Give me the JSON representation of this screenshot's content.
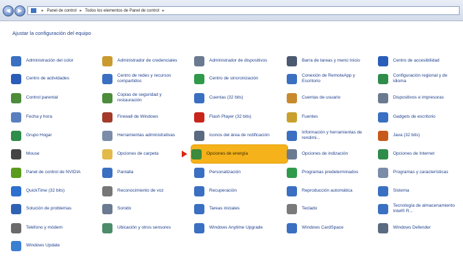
{
  "address_bar": {
    "path": [
      "Panel de control",
      "Todos los elementos de Panel de control"
    ]
  },
  "heading": "Ajustar la configuración del equipo",
  "items": [
    {
      "label": "Administración del color",
      "icon": "color-management-icon",
      "color": "#3a6fc2"
    },
    {
      "label": "Centro de actividades",
      "icon": "flag-icon",
      "color": "#2a5db8"
    },
    {
      "label": "Control parental",
      "icon": "parental-control-icon",
      "color": "#4c8c3a"
    },
    {
      "label": "Fecha y hora",
      "icon": "clock-icon",
      "color": "#5a7fbf"
    },
    {
      "label": "Grupo Hogar",
      "icon": "homegroup-icon",
      "color": "#2f8c4a"
    },
    {
      "label": "Mouse",
      "icon": "mouse-icon",
      "color": "#444444"
    },
    {
      "label": "Panel de control de NVIDIA",
      "icon": "nvidia-icon",
      "color": "#5a9a1c"
    },
    {
      "label": "QuickTime (32 bits)",
      "icon": "quicktime-icon",
      "color": "#2e6fd0"
    },
    {
      "label": "Solución de problemas",
      "icon": "troubleshoot-icon",
      "color": "#2f62b3"
    },
    {
      "label": "Teléfono y módem",
      "icon": "phone-icon",
      "color": "#6a6a6a"
    },
    {
      "label": "Windows Update",
      "icon": "windows-update-icon",
      "color": "#3b7fd1"
    },
    {
      "label": "Administrador de credenciales",
      "icon": "credentials-icon",
      "color": "#c99a2e"
    },
    {
      "label": "Centro de redes y recursos compartidos",
      "icon": "network-icon",
      "color": "#3a6fc2"
    },
    {
      "label": "Copias de seguridad y restauración",
      "icon": "backup-icon",
      "color": "#4c8c3a"
    },
    {
      "label": "Firewall de Windows",
      "icon": "firewall-icon",
      "color": "#a33a2a"
    },
    {
      "label": "Herramientas administrativas",
      "icon": "admin-tools-icon",
      "color": "#7a8ca8"
    },
    {
      "label": "Opciones de carpeta",
      "icon": "folder-icon",
      "color": "#e2b94a"
    },
    {
      "label": "Pantalla",
      "icon": "display-icon",
      "color": "#3a6fc2"
    },
    {
      "label": "Reconocimiento de voz",
      "icon": "microphone-icon",
      "color": "#777777"
    },
    {
      "label": "Sonido",
      "icon": "sound-icon",
      "color": "#6a7a90"
    },
    {
      "label": "Ubicación y otros sensores",
      "icon": "sensor-icon",
      "color": "#4c8c6a"
    },
    {
      "label": "Administrador de dispositivos",
      "icon": "device-manager-icon",
      "color": "#6a7a90"
    },
    {
      "label": "Centro de sincronización",
      "icon": "sync-icon",
      "color": "#2f9a4a"
    },
    {
      "label": "Cuentas (32 bits)",
      "icon": "accounts-icon",
      "color": "#3a6fc2"
    },
    {
      "label": "Flash Player (32 bits)",
      "icon": "flash-icon",
      "color": "#c7251b"
    },
    {
      "label": "Iconos del área de notificación",
      "icon": "notification-icon",
      "color": "#5a6a80"
    },
    {
      "label": "Opciones de energía",
      "icon": "power-icon",
      "color": "#3c8a3a"
    },
    {
      "label": "Personalización",
      "icon": "personalize-icon",
      "color": "#3a6fc2"
    },
    {
      "label": "Recuperación",
      "icon": "recovery-icon",
      "color": "#3a6fc2"
    },
    {
      "label": "Tareas iniciales",
      "icon": "tasks-icon",
      "color": "#3a6fc2"
    },
    {
      "label": "Windows Anytime Upgrade",
      "icon": "upgrade-icon",
      "color": "#3a6fc2"
    },
    {
      "label": "Barra de tareas y menú Inicio",
      "icon": "taskbar-icon",
      "color": "#4a5a70"
    },
    {
      "label": "Conexión de RemoteApp y Escritorio",
      "icon": "remoteapp-icon",
      "color": "#3a6fc2"
    },
    {
      "label": "Cuentas de usuario",
      "icon": "user-accounts-icon",
      "color": "#c98a2e"
    },
    {
      "label": "Fuentes",
      "icon": "fonts-icon",
      "color": "#c9a02e"
    },
    {
      "label": "Información y herramientas de rendimi...",
      "icon": "performance-icon",
      "color": "#3a6fc2"
    },
    {
      "label": "Opciones de indización",
      "icon": "indexing-icon",
      "color": "#6a7a90"
    },
    {
      "label": "Programas predeterminados",
      "icon": "default-programs-icon",
      "color": "#2f9a4a"
    },
    {
      "label": "Reproducción automática",
      "icon": "autoplay-icon",
      "color": "#3a6fc2"
    },
    {
      "label": "Teclado",
      "icon": "keyboard-icon",
      "color": "#7a7a7a"
    },
    {
      "label": "Windows CardSpace",
      "icon": "cardspace-icon",
      "color": "#3a6fc2"
    },
    {
      "label": "Centro de accesibilidad",
      "icon": "accessibility-icon",
      "color": "#2a5db8"
    },
    {
      "label": "Configuración regional y de idioma",
      "icon": "region-icon",
      "color": "#2f8c4a"
    },
    {
      "label": "Dispositivos e impresoras",
      "icon": "printer-icon",
      "color": "#6a7a90"
    },
    {
      "label": "Gadgets de escritorio",
      "icon": "gadgets-icon",
      "color": "#3a6fc2"
    },
    {
      "label": "Java (32 bits)",
      "icon": "java-icon",
      "color": "#c75a1b"
    },
    {
      "label": "Opciones de Internet",
      "icon": "internet-icon",
      "color": "#2f8c4a"
    },
    {
      "label": "Programas y características",
      "icon": "programs-icon",
      "color": "#7a8ca8"
    },
    {
      "label": "Sistema",
      "icon": "system-icon",
      "color": "#3a6fc2"
    },
    {
      "label": "Tecnología de almacenamiento Intel® R...",
      "icon": "storage-icon",
      "color": "#3a6fc2"
    },
    {
      "label": "Windows Defender",
      "icon": "defender-icon",
      "color": "#5a6a80"
    }
  ]
}
